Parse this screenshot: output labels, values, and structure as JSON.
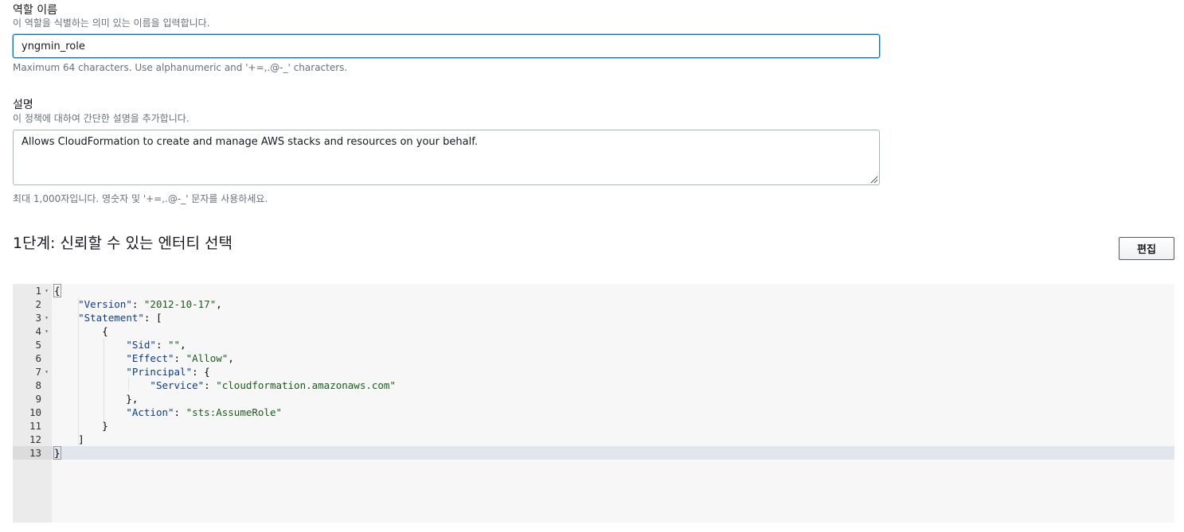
{
  "role_name": {
    "label": "역할 이름",
    "hint": "이 역할을 식별하는 의미 있는 이름을 입력합니다.",
    "value": "yngmin_role",
    "constraint": "Maximum 64 characters. Use alphanumeric and '+=,.@-_' characters."
  },
  "description": {
    "label": "설명",
    "hint": "이 정책에 대하여 간단한 설명을 추가합니다.",
    "value": "Allows CloudFormation to create and manage AWS stacks and resources on your behalf.",
    "constraint": "최대 1,000자입니다. 영숫자 및 '+=,.@-_' 문자를 사용하세요."
  },
  "step1": {
    "title": "1단계: 신뢰할 수 있는 엔터티 선택",
    "edit_label": "편집"
  },
  "editor": {
    "lines": [
      {
        "num": "1",
        "text": "{",
        "foldable": true
      },
      {
        "num": "2",
        "text": "    \"Version\": \"2012-10-17\",",
        "foldable": false
      },
      {
        "num": "3",
        "text": "    \"Statement\": [",
        "foldable": true
      },
      {
        "num": "4",
        "text": "        {",
        "foldable": true
      },
      {
        "num": "5",
        "text": "            \"Sid\": \"\",",
        "foldable": false
      },
      {
        "num": "6",
        "text": "            \"Effect\": \"Allow\",",
        "foldable": false
      },
      {
        "num": "7",
        "text": "            \"Principal\": {",
        "foldable": true
      },
      {
        "num": "8",
        "text": "                \"Service\": \"cloudformation.amazonaws.com\"",
        "foldable": false
      },
      {
        "num": "9",
        "text": "            },",
        "foldable": false
      },
      {
        "num": "10",
        "text": "            \"Action\": \"sts:AssumeRole\"",
        "foldable": false
      },
      {
        "num": "11",
        "text": "        }",
        "foldable": false
      },
      {
        "num": "12",
        "text": "    ]",
        "foldable": false
      },
      {
        "num": "13",
        "text": "}",
        "foldable": false
      }
    ],
    "active_line": "13",
    "colors": {
      "key": "#0b3c8c",
      "string": "#1a5c1a",
      "punct": "#000000"
    }
  }
}
